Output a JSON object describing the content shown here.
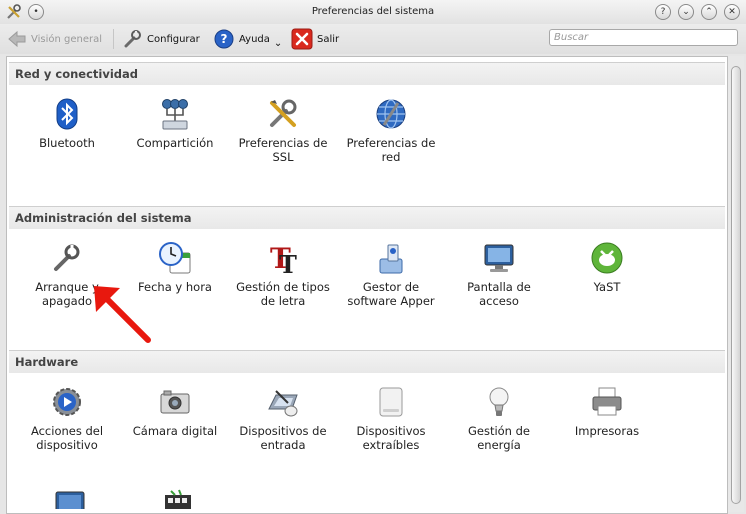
{
  "window": {
    "title": "Preferencias del sistema"
  },
  "toolbar": {
    "overview_label": "Visión general",
    "configure_label": "Configurar",
    "help_label": "Ayuda",
    "quit_label": "Salir"
  },
  "search": {
    "placeholder": "Buscar"
  },
  "sections": [
    {
      "title": "Red y conectividad",
      "items": [
        {
          "label": "Bluetooth",
          "icon": "bluetooth-icon"
        },
        {
          "label": "Compartición",
          "icon": "network-share-icon"
        },
        {
          "label": "Preferencias de SSL",
          "icon": "tools-icon"
        },
        {
          "label": "Preferencias de red",
          "icon": "globe-icon"
        }
      ]
    },
    {
      "title": "Administración del sistema",
      "items": [
        {
          "label": "Arranque y apagado",
          "icon": "wrench-icon"
        },
        {
          "label": "Fecha y hora",
          "icon": "clock-calendar-icon"
        },
        {
          "label": "Gestión de tipos de letra",
          "icon": "font-icon"
        },
        {
          "label": "Gestor de software Apper",
          "icon": "software-icon"
        },
        {
          "label": "Pantalla de acceso",
          "icon": "monitor-icon"
        },
        {
          "label": "YaST",
          "icon": "yast-icon"
        }
      ]
    },
    {
      "title": "Hardware",
      "items": [
        {
          "label": "Acciones del dispositivo",
          "icon": "gear-play-icon"
        },
        {
          "label": "Cámara digital",
          "icon": "camera-icon"
        },
        {
          "label": "Dispositivos de entrada",
          "icon": "tablet-mouse-icon"
        },
        {
          "label": "Dispositivos extraíbles",
          "icon": "drive-icon"
        },
        {
          "label": "Gestión de energía",
          "icon": "bulb-icon"
        },
        {
          "label": "Impresoras",
          "icon": "printer-icon"
        }
      ]
    }
  ],
  "colors": {
    "annotation_arrow": "#e8180e",
    "accent": "#2a63c7"
  }
}
